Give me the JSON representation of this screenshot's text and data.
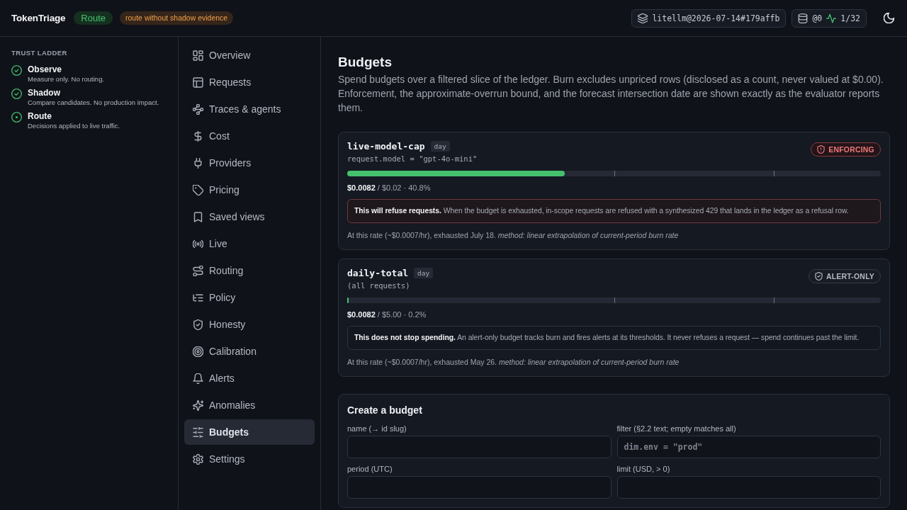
{
  "header": {
    "logo": "TokenTriage",
    "mode": "Route",
    "warning": "route without shadow evidence",
    "build": "litellm@2026-07-14#179affb",
    "db_status": "@0",
    "activity": "1/32"
  },
  "trust_ladder": {
    "title": "TRUST LADDER",
    "steps": [
      {
        "name": "Observe",
        "description": "Measure only. No routing.",
        "done": true
      },
      {
        "name": "Shadow",
        "description": "Compare candidates. No production impact.",
        "done": true
      },
      {
        "name": "Route",
        "description": "Decisions applied to live traffic.",
        "done": false
      }
    ]
  },
  "nav": {
    "items": [
      {
        "label": "Overview",
        "selected": false
      },
      {
        "label": "Requests",
        "selected": false
      },
      {
        "label": "Traces & agents",
        "selected": false
      },
      {
        "label": "Cost",
        "selected": false
      },
      {
        "label": "Providers",
        "selected": false
      },
      {
        "label": "Pricing",
        "selected": false
      },
      {
        "label": "Saved views",
        "selected": false
      },
      {
        "label": "Live",
        "selected": false
      },
      {
        "label": "Routing",
        "selected": false
      },
      {
        "label": "Policy",
        "selected": false
      },
      {
        "label": "Honesty",
        "selected": false
      },
      {
        "label": "Calibration",
        "selected": false
      },
      {
        "label": "Alerts",
        "selected": false
      },
      {
        "label": "Anomalies",
        "selected": false
      },
      {
        "label": "Budgets",
        "selected": true
      },
      {
        "label": "Settings",
        "selected": false
      }
    ]
  },
  "page": {
    "title": "Budgets",
    "description": "Spend budgets over a filtered slice of the ledger. Burn excludes unpriced rows (disclosed as a count, never valued at $0.00). Enforcement, the approximate-overrun bound, and the forecast intersection date are shown exactly as the evaluator reports them."
  },
  "budgets": [
    {
      "name": "live-model-cap",
      "period": "day",
      "filter": "request.model = \"gpt-4o-mini\"",
      "status": {
        "kind": "enforcing",
        "label": "ENFORCING"
      },
      "level": 0.408,
      "spend": "**$0.0082** / $0.02 · 40.8%",
      "notice": "**This will refuse requests.** When the budget is exhausted, in-scope requests are refused with a synthesized 429 that lands in the ledger as a refusal row.",
      "forecast": "At this rate (~$0.0007/hr), exhausted July 18. *method: linear extrapolation of current-period burn rate*"
    },
    {
      "name": "daily-total",
      "period": "day",
      "filter": "(all requests)",
      "status": {
        "kind": "alerting",
        "label": "ALERT-ONLY"
      },
      "level": 0.002,
      "spend": "**$0.0082** / $5.00 · 0.2%",
      "notice": "**This does not stop spending.** An alert-only budget tracks burn and fires alerts at its thresholds. It never refuses a request — spend continues past the limit.",
      "forecast": "At this rate (~$0.0007/hr), exhausted May 26. *method: linear extrapolation of current-period burn rate*"
    }
  ],
  "create_form": {
    "title": "Create a budget",
    "fields": [
      {
        "label": "name (→ id slug)"
      },
      {
        "label": "filter (§2.2 text; empty matches all)",
        "placeholder": "dim.env = \"prod\""
      },
      {
        "label": "period (UTC)"
      },
      {
        "label": "limit (USD, > 0)"
      }
    ]
  }
}
